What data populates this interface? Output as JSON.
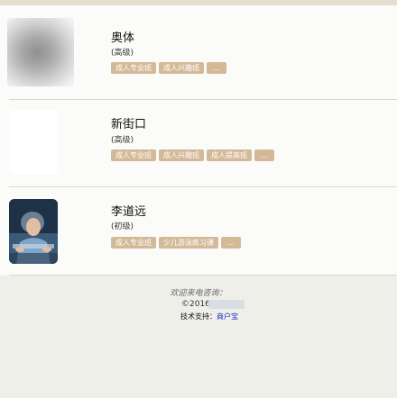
{
  "coaches": [
    {
      "name": "奥体",
      "level": "(高级)",
      "tags": [
        "成人专业班",
        "成人兴趣班",
        "..."
      ],
      "avatar": "blurred-avatar"
    },
    {
      "name": "新街口",
      "level": "(高级)",
      "tags": [
        "成人专业班",
        "成人兴趣班",
        "成人提高班",
        "..."
      ],
      "avatar": "blank-avatar"
    },
    {
      "name": "李道远",
      "level": "(初级)",
      "tags": [
        "成人专业班",
        "少儿游泳练习课",
        "..."
      ],
      "avatar": "coach-photo"
    }
  ],
  "footer": {
    "welcome": "欢迎来电咨询：",
    "copyright": "©2016",
    "support_label": "技术支持：",
    "support_link": "商户宝"
  },
  "colors": {
    "tag_bg": "#d4b998",
    "page_bg": "#efefea",
    "link": "#1a2bc7"
  }
}
